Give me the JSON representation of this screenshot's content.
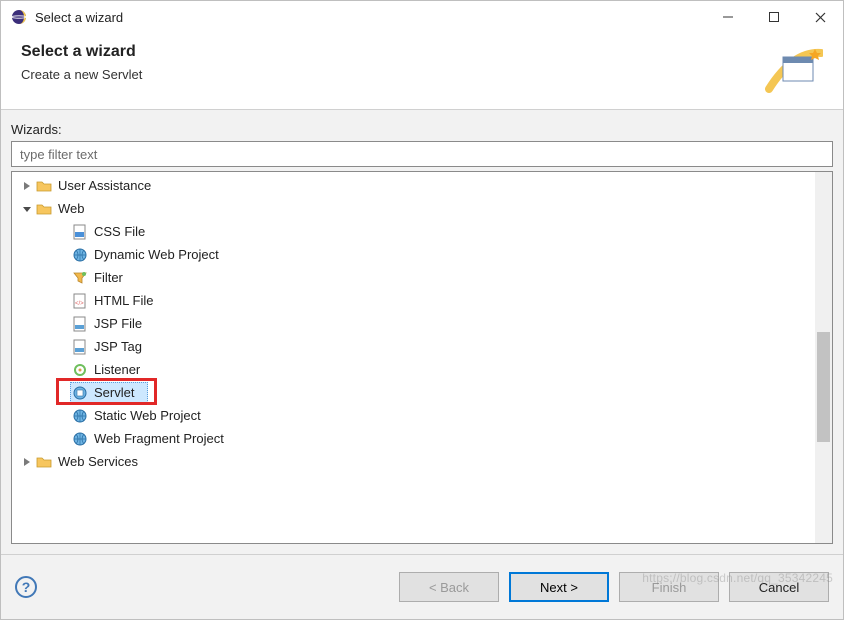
{
  "titlebar": {
    "title": "Select a wizard"
  },
  "header": {
    "heading": "Select a wizard",
    "subheading": "Create a new Servlet"
  },
  "body": {
    "wizards_label": "Wizards:",
    "filter_placeholder": "type filter text",
    "tree": {
      "items": [
        {
          "label": "User Assistance",
          "depth": 1,
          "expander": "closed",
          "icon": "folder"
        },
        {
          "label": "Web",
          "depth": 1,
          "expander": "open",
          "icon": "folder"
        },
        {
          "label": "CSS File",
          "depth": 2,
          "expander": "none",
          "icon": "css-file"
        },
        {
          "label": "Dynamic Web Project",
          "depth": 2,
          "expander": "none",
          "icon": "globe-proj"
        },
        {
          "label": "Filter",
          "depth": 2,
          "expander": "none",
          "icon": "filter"
        },
        {
          "label": "HTML File",
          "depth": 2,
          "expander": "none",
          "icon": "html-file"
        },
        {
          "label": "JSP File",
          "depth": 2,
          "expander": "none",
          "icon": "jsp-file"
        },
        {
          "label": "JSP Tag",
          "depth": 2,
          "expander": "none",
          "icon": "jsp-tag"
        },
        {
          "label": "Listener",
          "depth": 2,
          "expander": "none",
          "icon": "listener"
        },
        {
          "label": "Servlet",
          "depth": 2,
          "expander": "none",
          "icon": "servlet",
          "selected": true,
          "highlight": true
        },
        {
          "label": "Static Web Project",
          "depth": 2,
          "expander": "none",
          "icon": "globe-static"
        },
        {
          "label": "Web Fragment Project",
          "depth": 2,
          "expander": "none",
          "icon": "globe-frag"
        },
        {
          "label": "Web Services",
          "depth": 1,
          "expander": "closed",
          "icon": "folder"
        }
      ]
    }
  },
  "footer": {
    "back": "< Back",
    "next": "Next >",
    "finish": "Finish",
    "cancel": "Cancel"
  },
  "watermark": "https://blog.csdn.net/qq_35342245"
}
